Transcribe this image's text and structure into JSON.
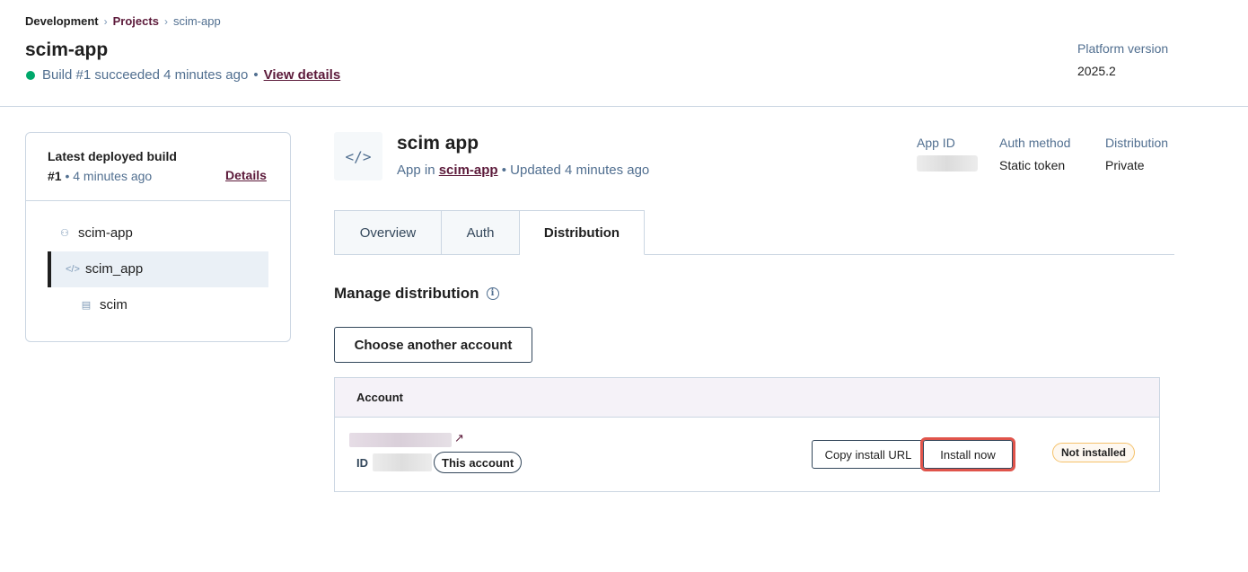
{
  "breadcrumb": {
    "items": [
      "Development",
      "Projects",
      "scim-app"
    ]
  },
  "header": {
    "title": "scim-app",
    "build_status_text": "Build #1 succeeded 4 minutes ago",
    "build_status_sep": "•",
    "view_details_label": "View details",
    "platform_label": "Platform version",
    "platform_value": "2025.2"
  },
  "build_card": {
    "title": "Latest deployed build",
    "build_number": "#1",
    "build_time": "• 4 minutes ago",
    "details_label": "Details",
    "tree": {
      "project": "scim-app",
      "app": "scim_app",
      "component": "scim"
    }
  },
  "app": {
    "icon": "</>",
    "title": "scim app",
    "sub_prefix": "App in",
    "sub_link": "scim-app",
    "sub_suffix": "• Updated 4 minutes ago",
    "meta": {
      "app_id_label": "App ID",
      "auth_label": "Auth method",
      "auth_value": "Static token",
      "dist_label": "Distribution",
      "dist_value": "Private"
    }
  },
  "tabs": [
    {
      "label": "Overview",
      "active": false
    },
    {
      "label": "Auth",
      "active": false
    },
    {
      "label": "Distribution",
      "active": true
    }
  ],
  "distribution": {
    "section_title": "Manage distribution",
    "choose_button": "Choose another account",
    "table_header": "Account",
    "row": {
      "id_label": "ID",
      "this_account_badge": "This account",
      "copy_url_button": "Copy install URL",
      "install_button": "Install now",
      "status_badge": "Not installed"
    }
  },
  "colors": {
    "accent": "#5c1a3a",
    "success": "#00a86b",
    "highlight": "#e0544b",
    "warning_border": "#f5c26b"
  }
}
